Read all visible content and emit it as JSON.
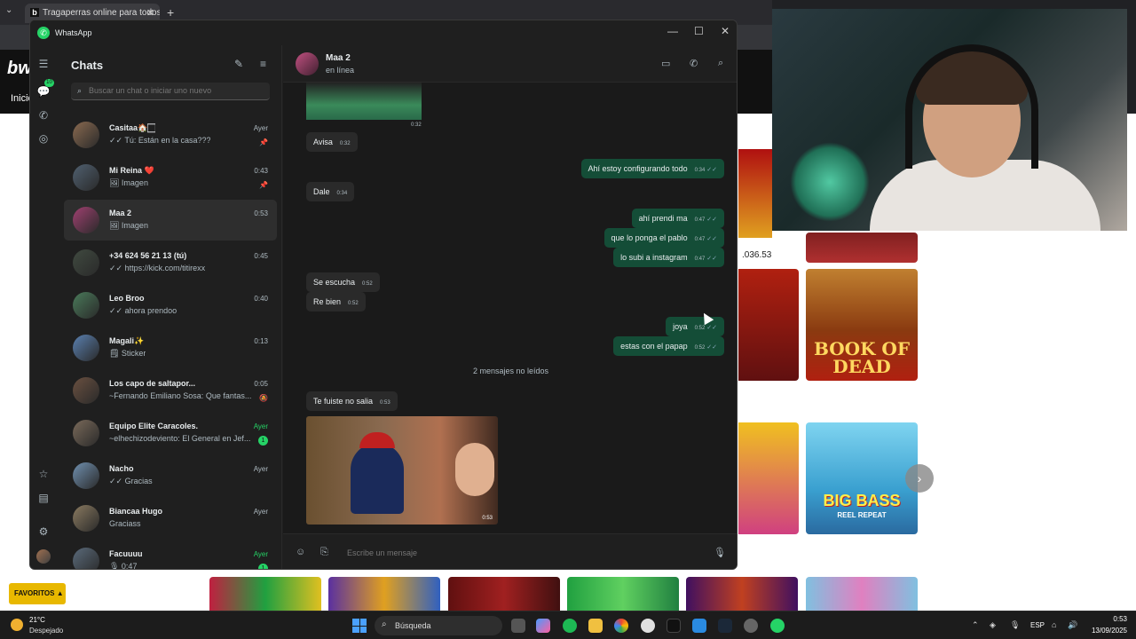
{
  "browser": {
    "tab_title": "Tragaperras online para todos l",
    "tab_favicon": "b",
    "site_logo": "bw",
    "site_nav": "Inicio",
    "amount": ".036.53",
    "favoritos": "FAVORITOS ▲",
    "games": {
      "book_of_dead": "BOOK OF DEAD",
      "big_bass": "BIG BASS",
      "big_bass_sub": "REEL REPEAT"
    }
  },
  "whatsapp": {
    "window_title": "WhatsApp",
    "rail_badge": "10",
    "list": {
      "title": "Chats",
      "search_placeholder": "Buscar un chat o iniciar uno nuevo",
      "chats": [
        {
          "name": "Casitaa🏠🏻",
          "preview": "✓✓ Tú: Están en la casa???",
          "time": "Ayer",
          "pinned": true,
          "avatar": "#8a6a50"
        },
        {
          "name": "Mi Reina ❤️",
          "preview": "🖼 Imagen",
          "time": "0:43",
          "pinned": true,
          "avatar": "#506070"
        },
        {
          "name": "Maa 2",
          "preview": "🖼 Imagen",
          "time": "0:53",
          "active": true,
          "avatar": "#a04070"
        },
        {
          "name": "+34 624 56 21 13 (tú)",
          "preview": "✓✓ https://kick.com/titirexx",
          "time": "0:45",
          "avatar": "#404a40"
        },
        {
          "name": "Leo Broo",
          "preview": "✓✓ ahora prendoo",
          "time": "0:40",
          "avatar": "#4a7a5a"
        },
        {
          "name": "Magali✨",
          "preview": "🗒 Sticker",
          "time": "0:13",
          "avatar": "#5a80b0"
        },
        {
          "name": "Los capo de saltapor...",
          "preview": "~Fernando Emiliano Sosa: Que fantas...",
          "time": "0:05",
          "muted": true,
          "avatar": "#6a5040"
        },
        {
          "name": "Equipo Elite Caracoles.",
          "preview": "~elhechizodeviento: El General en Jef...",
          "time": "Ayer",
          "unread": "1",
          "green": true,
          "avatar": "#7a6a5a"
        },
        {
          "name": "Nacho",
          "preview": "✓✓ Gracias",
          "time": "Ayer",
          "avatar": "#7090b0"
        },
        {
          "name": "Biancaa Hugo",
          "preview": "Graciass",
          "time": "Ayer",
          "avatar": "#8a7a60"
        },
        {
          "name": "Facuuuu",
          "preview": "🎙 0:47",
          "time": "Ayer",
          "unread": "1",
          "green": true,
          "avatar": "#5a6a7a"
        }
      ]
    },
    "conversation": {
      "name": "Maa 2",
      "status": "en línea",
      "first_image_time": "0:32",
      "messages": [
        {
          "dir": "in",
          "text": "Avisa",
          "time": "0:32"
        },
        {
          "dir": "out",
          "text": "Ahí estoy configurando todo",
          "time": "0:34"
        },
        {
          "dir": "in",
          "text": "Dale",
          "time": "0:34"
        },
        {
          "dir": "out",
          "text": "ahí prendi ma",
          "time": "0:47"
        },
        {
          "dir": "out",
          "text": "que lo ponga el pablo",
          "time": "0:47"
        },
        {
          "dir": "out",
          "text": "lo subi a instagram",
          "time": "0:47"
        },
        {
          "dir": "in",
          "text": "Se escucha",
          "time": "0:52"
        },
        {
          "dir": "in",
          "text": "Re bien",
          "time": "0:52"
        },
        {
          "dir": "out",
          "text": "joya",
          "time": "0:52"
        },
        {
          "dir": "out",
          "text": "estas con  el papap",
          "time": "0:52"
        },
        {
          "dir": "in",
          "text": "Te fuiste no salia",
          "time": "0:53"
        }
      ],
      "unread_divider": "2 mensajes no leídos",
      "image_time": "0:53",
      "composer_placeholder": "Escribe un mensaje"
    }
  },
  "taskbar": {
    "weather_temp": "21°C",
    "weather_desc": "Despejado",
    "search_label": "Búsqueda",
    "lang": "ESP",
    "time": "0:53",
    "date": "13/09/2025"
  }
}
